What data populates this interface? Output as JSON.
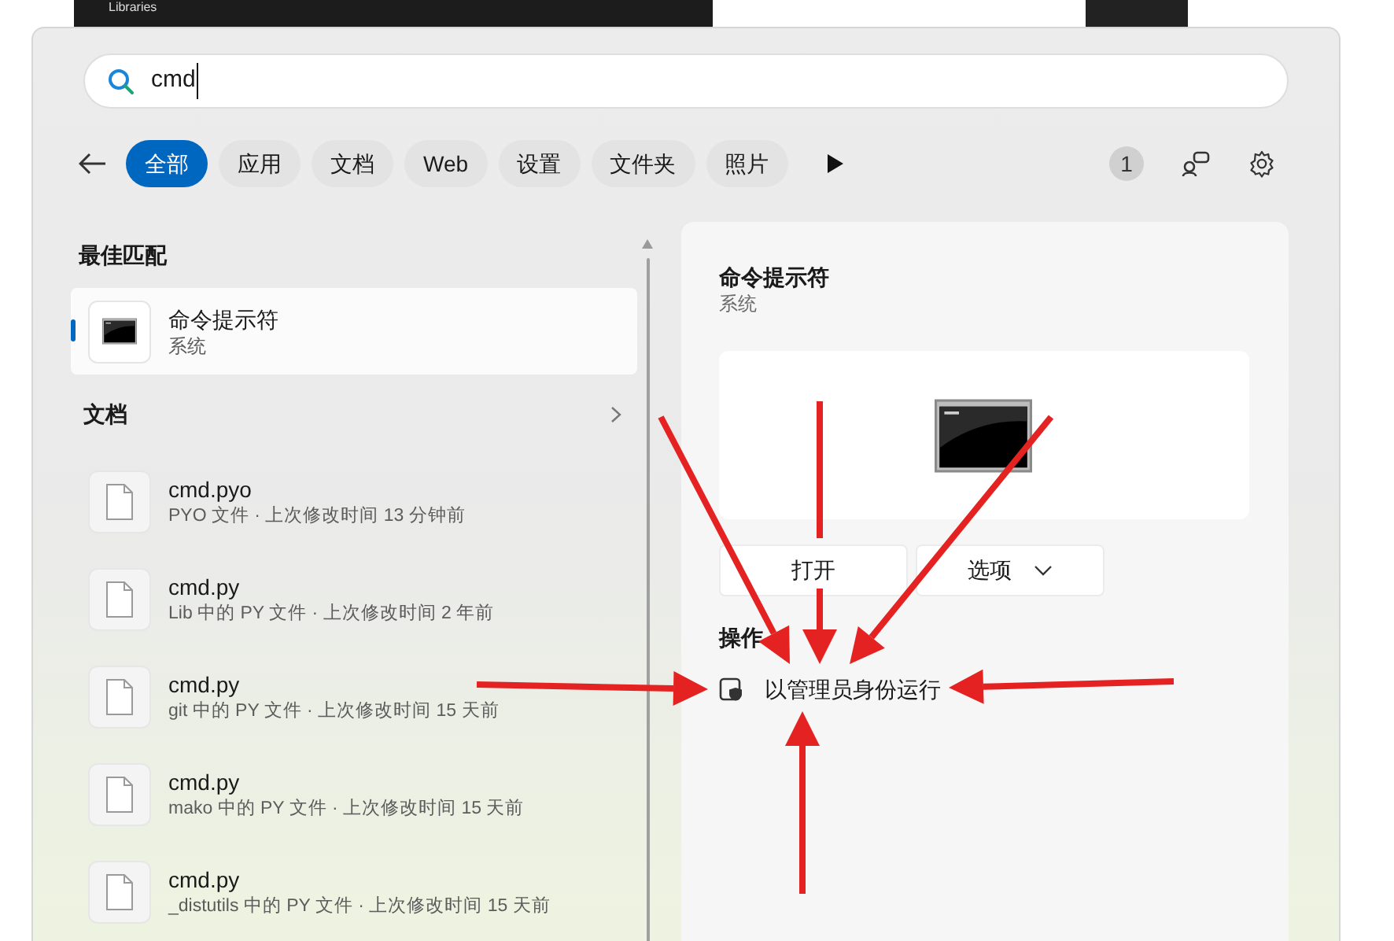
{
  "background_window": {
    "sidebar_item": "Libraries"
  },
  "search": {
    "value": "cmd"
  },
  "filters": [
    {
      "label": "全部",
      "selected": true
    },
    {
      "label": "应用",
      "selected": false
    },
    {
      "label": "文档",
      "selected": false
    },
    {
      "label": "Web",
      "selected": false
    },
    {
      "label": "设置",
      "selected": false
    },
    {
      "label": "文件夹",
      "selected": false
    },
    {
      "label": "照片",
      "selected": false
    }
  ],
  "rewards_badge": "1",
  "best_match": {
    "heading": "最佳匹配",
    "title": "命令提示符",
    "subtitle": "系统",
    "selected": true
  },
  "documents": {
    "heading": "文档",
    "items": [
      {
        "name": "cmd.pyo",
        "detail": "PYO 文件 · 上次修改时间 13 分钟前"
      },
      {
        "name": "cmd.py",
        "detail": "Lib 中的 PY 文件 · 上次修改时间 2 年前"
      },
      {
        "name": "cmd.py",
        "detail": "git 中的 PY 文件 · 上次修改时间 15 天前"
      },
      {
        "name": "cmd.py",
        "detail": "mako 中的 PY 文件 · 上次修改时间 15 天前"
      },
      {
        "name": "cmd.py",
        "detail": "_distutils 中的 PY 文件 · 上次修改时间 15 天前"
      }
    ]
  },
  "preview": {
    "title": "命令提示符",
    "subtitle": "系统",
    "buttons": [
      {
        "label": "打开",
        "kind": "plain"
      },
      {
        "label": "选项",
        "kind": "dropdown"
      }
    ],
    "actions_heading": "操作",
    "actions": [
      {
        "label": "以管理员身份运行"
      }
    ]
  }
}
